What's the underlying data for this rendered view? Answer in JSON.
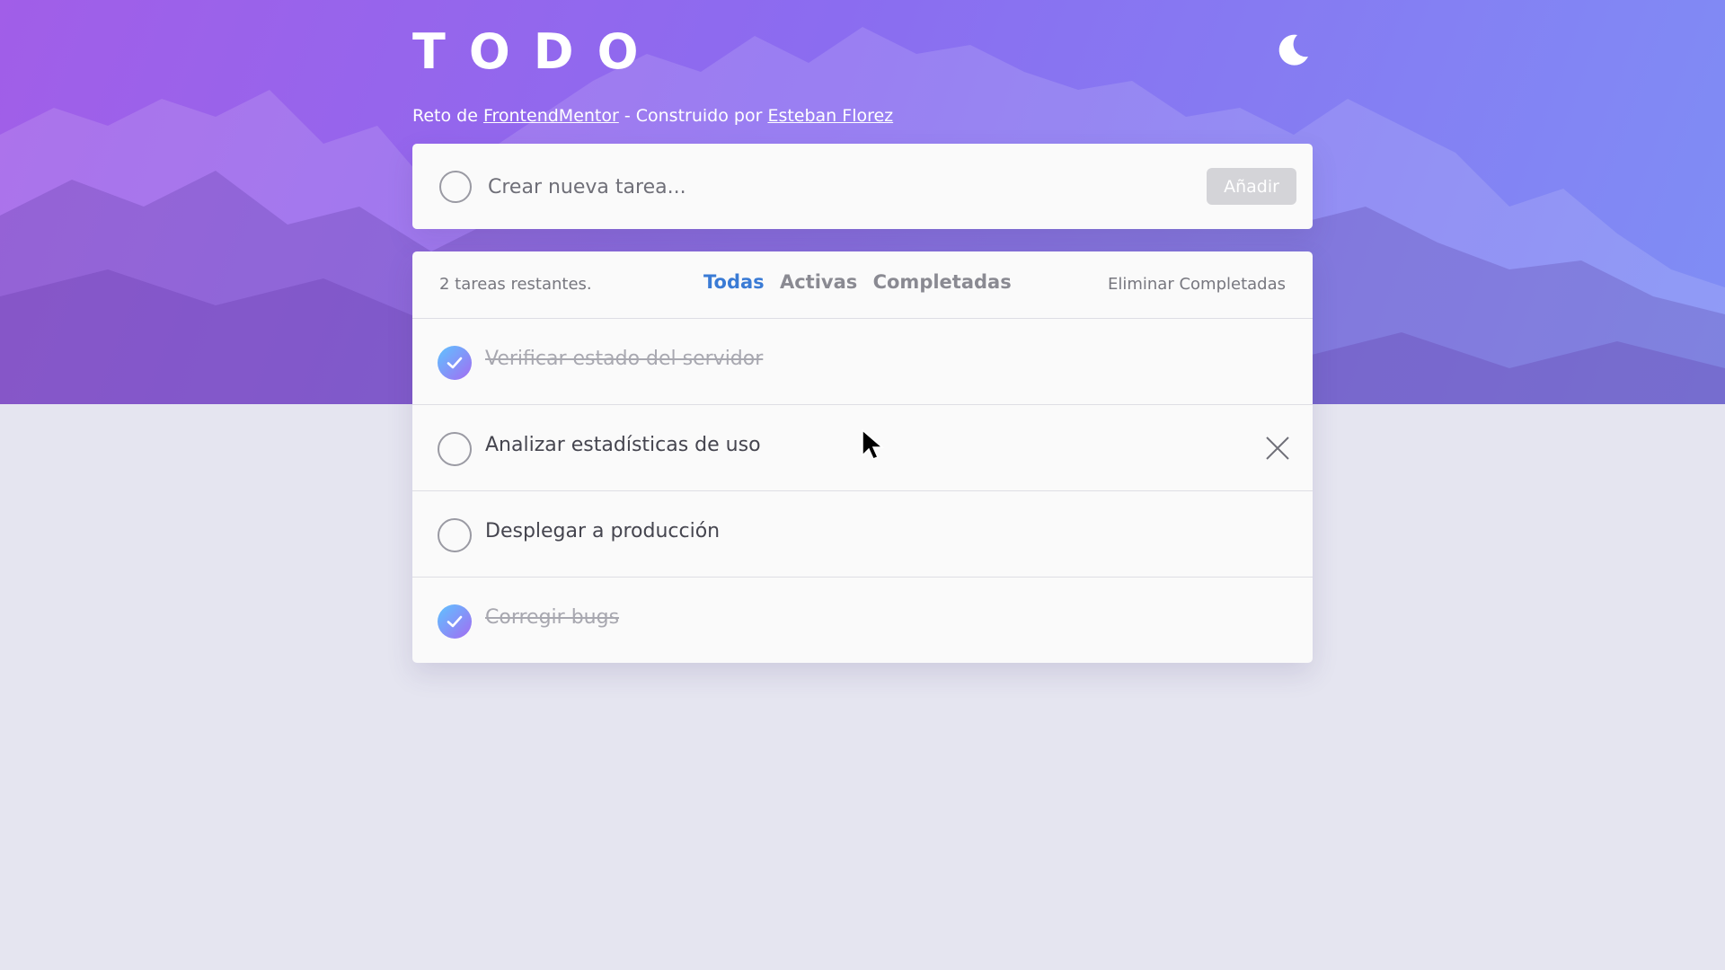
{
  "header": {
    "title": "TODO",
    "theme_icon": "moon-icon"
  },
  "credits": {
    "prefix": "Reto de ",
    "challenge_link": "FrontendMentor",
    "middle": " - Construido por ",
    "author_link": "Esteban Florez"
  },
  "new_task": {
    "placeholder": "Crear nueva tarea...",
    "value": "",
    "add_label": "Añadir"
  },
  "list": {
    "remaining": "2 tareas restantes.",
    "filters": [
      {
        "label": "Todas",
        "active": true
      },
      {
        "label": "Activas",
        "active": false
      },
      {
        "label": "Completadas",
        "active": false
      }
    ],
    "clear_label": "Eliminar Completadas",
    "items": [
      {
        "text": "Verificar estado del servidor",
        "completed": true
      },
      {
        "text": "Analizar estadísticas de uso",
        "completed": false
      },
      {
        "text": "Desplegar a producción",
        "completed": false
      },
      {
        "text": "Corregir bugs",
        "completed": true
      }
    ]
  },
  "colors": {
    "accent": "#3a7bd5",
    "check_gradient_start": "#5ec3ff",
    "check_gradient_end": "#a36cf2",
    "hero_gradient_start": "#a15ee8",
    "hero_gradient_end": "#7f8ef5",
    "background": "#e5e5f0"
  }
}
